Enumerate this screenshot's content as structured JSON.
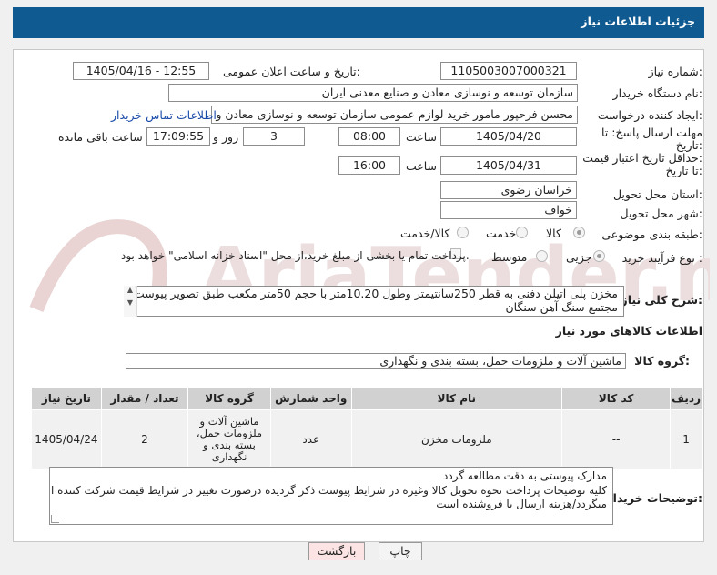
{
  "header": {
    "title": "جزئیات اطلاعات نیاز"
  },
  "form": {
    "need_number": {
      "label": "شماره نیاز:",
      "value": "1105003007000321"
    },
    "announce_datetime": {
      "label": "تاریخ و ساعت اعلان عمومی:",
      "value": "1405/04/16 - 12:55"
    },
    "buyer_org": {
      "label": "نام دستگاه خریدار:",
      "value": "سازمان توسعه و نوسازی معادن و صنایع معدنی ایران"
    },
    "creator": {
      "label": "ایجاد کننده درخواست:",
      "value": "محسن فرحپور مامور خرید لوازم عمومی سازمان توسعه و نوسازی معادن و صنایع",
      "contact_link": "اطلاعات تماس خریدار"
    },
    "reply_deadline": {
      "label_line1": "مهلت ارسال پاسخ: تا",
      "label_line2": "تاریخ:",
      "date": "1405/04/20",
      "time_label": "ساعت",
      "time": "08:00",
      "days": "3",
      "days_label": "روز و",
      "remaining": "17:09:55",
      "remaining_label": "ساعت باقی مانده"
    },
    "price_validity": {
      "label_line1": "حداقل تاریخ اعتبار قیمت:",
      "label_line2": "تا تاریخ:",
      "date": "1405/04/31",
      "time_label": "ساعت",
      "time": "16:00"
    },
    "province": {
      "label": "استان محل تحویل:",
      "value": "خراسان رضوی"
    },
    "city": {
      "label": "شهر محل تحویل:",
      "value": "خواف"
    },
    "category": {
      "label": "طبقه بندی موضوعی:",
      "options": [
        "کالا",
        "خدمت",
        "کالا/خدمت"
      ],
      "selected": "کالا"
    },
    "process": {
      "label": "نوع فرآیند خرید :",
      "options": [
        "جزیی",
        "متوسط"
      ],
      "selected": "جزیی",
      "payment_note": "پرداخت تمام یا بخشی از مبلغ خرید،از محل \"اسناد خزانه اسلامی\" خواهد بود."
    },
    "description": {
      "label": "شرح کلی نیاز:",
      "value": "مخزن پلی اتیلن دفنی به قطر 250سانتیمتر وطول 10.20متر با حجم 50متر مکعب طبق تصویر پیوست مجتمع سنگ آهن سنگان"
    }
  },
  "goods": {
    "section_title": "اطلاعات کالاهای مورد نیاز",
    "group_label": "گروه کالا:",
    "group_value": "ماشین آلات و ملزومات حمل، بسته بندی و نگهداری",
    "columns": [
      "ردیف",
      "کد کالا",
      "نام کالا",
      "واحد شمارش",
      "گروه کالا",
      "تعداد / مقدار",
      "تاریخ نیاز"
    ],
    "rows": [
      {
        "row": "1",
        "code": "--",
        "name": "ملزومات مخزن",
        "unit": "عدد",
        "group": "ماشین آلات و ملزومات حمل، بسته بندی و نگهداری",
        "qty": "2",
        "date": "1405/04/24"
      }
    ]
  },
  "buyer_notes": {
    "label": "توضیحات خریدار:",
    "line1": "مدارک پیوستی به دقت مطالعه گردد",
    "line2": "کلیه توضیحات پرداخت نحوه تحویل کالا وغیره در شرایط پیوست ذکر گردیده درصورت تغییر در شرایط  قیمت شرکت کننده ابطال",
    "line3": "میگردد/هزینه ارسال با فروشنده است"
  },
  "buttons": {
    "print": "چاپ",
    "back": "بازگشت"
  },
  "watermark": {
    "text": "AriaTender.net"
  },
  "colors": {
    "header": "#0f5a91",
    "link": "#1a4aa8",
    "back_button_bg": "#fce4e4",
    "watermark": "#e9d3d3"
  }
}
